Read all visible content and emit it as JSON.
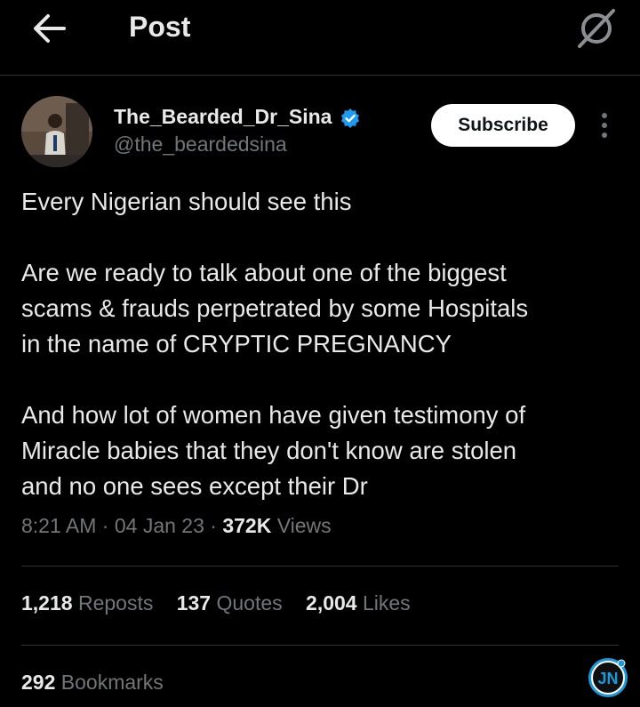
{
  "header": {
    "title": "Post",
    "back_icon": "arrow-left-icon",
    "grok_icon": "grok-icon"
  },
  "author": {
    "display_name": "The_Bearded_Dr_Sina",
    "handle": "@the_beardedsina",
    "verified": true,
    "verified_color": "#1d9bf0",
    "subscribe_label": "Subscribe"
  },
  "post": {
    "lines": [
      "Every Nigerian should see this",
      "",
      "Are we ready to talk about one of the biggest",
      "scams & frauds perpetrated by some Hospitals",
      "in the name of CRYPTIC PREGNANCY",
      "",
      "And how lot of women have given testimony of",
      "Miracle babies that they don't know are stolen",
      "and no one sees except their Dr"
    ],
    "time": "8:21 AM",
    "sep": "·",
    "date": "04 Jan 23",
    "views_count": "372K",
    "views_label": "Views"
  },
  "stats": {
    "reposts_count": "1,218",
    "reposts_label": "Reposts",
    "quotes_count": "137",
    "quotes_label": "Quotes",
    "likes_count": "2,004",
    "likes_label": "Likes",
    "bookmarks_count": "292",
    "bookmarks_label": "Bookmarks"
  },
  "watermark": {
    "text": "JN",
    "color": "#1a9ad9"
  },
  "colors": {
    "background": "#000000",
    "text": "#e7e9ea",
    "muted": "#71767b",
    "divider": "#2f3336"
  }
}
